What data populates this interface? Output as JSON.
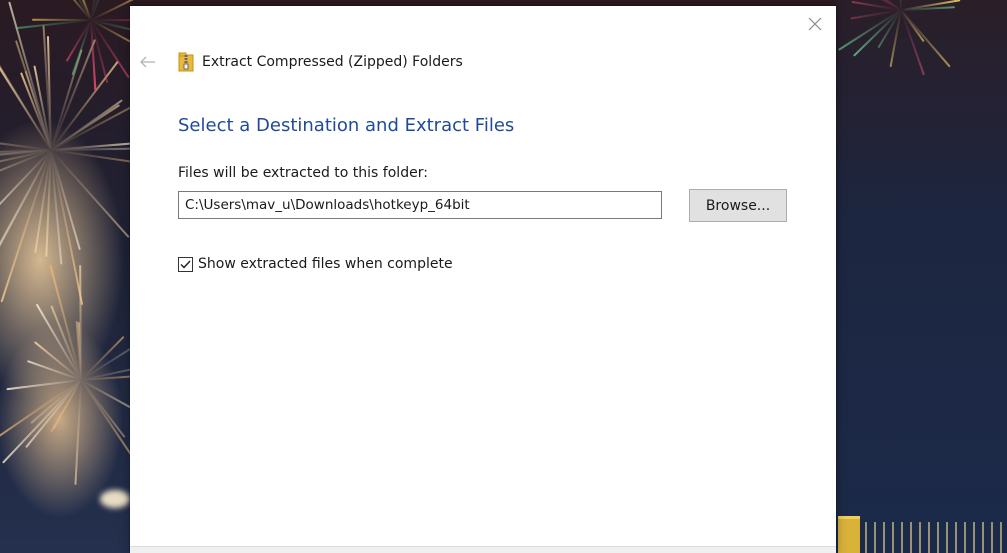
{
  "dialog": {
    "title": "Extract Compressed (Zipped) Folders",
    "heading": "Select a Destination and Extract Files",
    "field_label": "Files will be extracted to this folder:",
    "destination_path": "C:\\Users\\mav_u\\Downloads\\hotkeyp_64bit",
    "browse_label": "Browse...",
    "show_files_label": "Show extracted files when complete",
    "show_files_checked": true
  },
  "icons": {
    "close": "close-icon",
    "back": "back-arrow-icon",
    "title": "zip-folder-icon",
    "check": "checkmark-icon"
  },
  "colors": {
    "heading": "#1f4a9a",
    "button_bg": "#e1e1e1",
    "dialog_bg": "#ffffff"
  }
}
